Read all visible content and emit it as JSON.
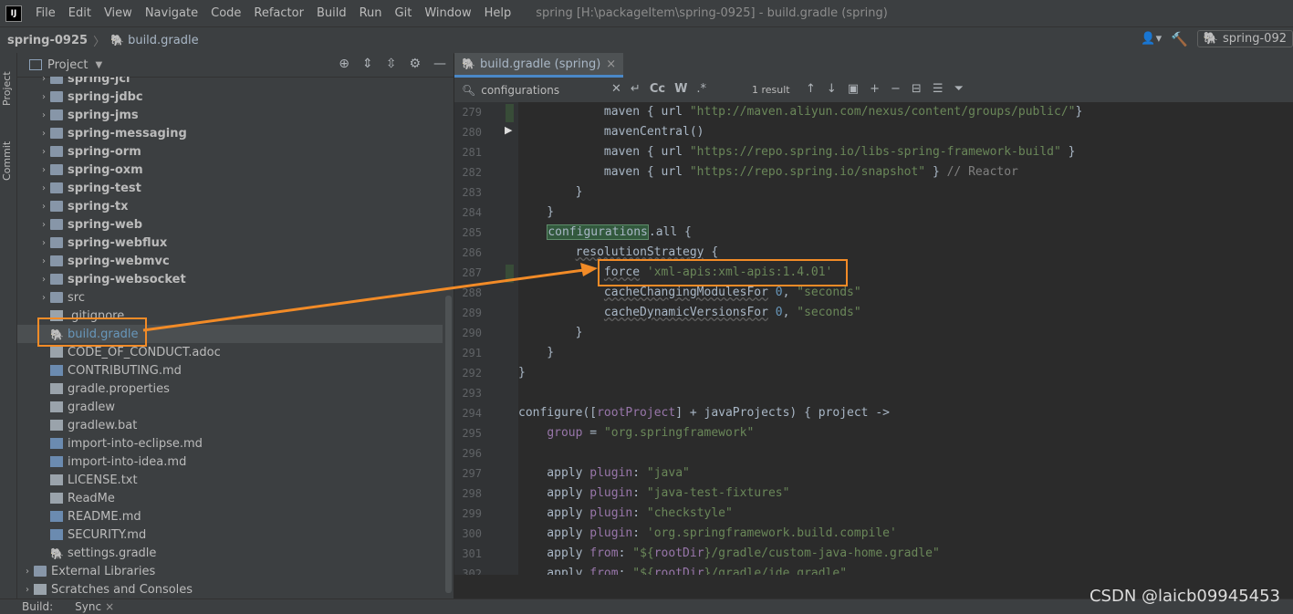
{
  "menubar": {
    "items": [
      "File",
      "Edit",
      "View",
      "Navigate",
      "Code",
      "Refactor",
      "Build",
      "Run",
      "Git",
      "Window",
      "Help"
    ],
    "window_title": "spring [H:\\packageItem\\spring-0925] - build.gradle (spring)"
  },
  "navbar": {
    "project": "spring-0925",
    "file": "build.gradle",
    "run_config": "spring-092"
  },
  "stripe": {
    "project_tab": "Project",
    "commit_tab": "Commit"
  },
  "project_panel": {
    "title": "Project",
    "tree": [
      {
        "label": "spring-jcl",
        "bold": true,
        "type": "module",
        "expand": true
      },
      {
        "label": "spring-jdbc",
        "bold": true,
        "type": "module",
        "expand": true
      },
      {
        "label": "spring-jms",
        "bold": true,
        "type": "module",
        "expand": true
      },
      {
        "label": "spring-messaging",
        "bold": true,
        "type": "module",
        "expand": true
      },
      {
        "label": "spring-orm",
        "bold": true,
        "type": "module",
        "expand": true
      },
      {
        "label": "spring-oxm",
        "bold": true,
        "type": "module",
        "expand": true
      },
      {
        "label": "spring-test",
        "bold": true,
        "type": "module",
        "expand": true
      },
      {
        "label": "spring-tx",
        "bold": true,
        "type": "module",
        "expand": true
      },
      {
        "label": "spring-web",
        "bold": true,
        "type": "module",
        "expand": true
      },
      {
        "label": "spring-webflux",
        "bold": true,
        "type": "module",
        "expand": true
      },
      {
        "label": "spring-webmvc",
        "bold": true,
        "type": "module",
        "expand": true
      },
      {
        "label": "spring-websocket",
        "bold": true,
        "type": "module",
        "expand": true
      },
      {
        "label": "src",
        "bold": false,
        "type": "folder",
        "expand": true
      },
      {
        "label": ".gitignore",
        "bold": false,
        "type": "doc",
        "expand": false
      },
      {
        "label": "build.gradle",
        "bold": false,
        "type": "gradle",
        "expand": false,
        "selected": true
      },
      {
        "label": "CODE_OF_CONDUCT.adoc",
        "bold": false,
        "type": "doc",
        "expand": false
      },
      {
        "label": "CONTRIBUTING.md",
        "bold": false,
        "type": "md",
        "expand": false
      },
      {
        "label": "gradle.properties",
        "bold": false,
        "type": "doc",
        "expand": false
      },
      {
        "label": "gradlew",
        "bold": false,
        "type": "doc",
        "expand": false
      },
      {
        "label": "gradlew.bat",
        "bold": false,
        "type": "doc",
        "expand": false
      },
      {
        "label": "import-into-eclipse.md",
        "bold": false,
        "type": "md",
        "expand": false
      },
      {
        "label": "import-into-idea.md",
        "bold": false,
        "type": "md",
        "expand": false
      },
      {
        "label": "LICENSE.txt",
        "bold": false,
        "type": "doc",
        "expand": false
      },
      {
        "label": "ReadMe",
        "bold": false,
        "type": "doc",
        "expand": false
      },
      {
        "label": "README.md",
        "bold": false,
        "type": "md",
        "expand": false
      },
      {
        "label": "SECURITY.md",
        "bold": false,
        "type": "md",
        "expand": false
      },
      {
        "label": "settings.gradle",
        "bold": false,
        "type": "gradle",
        "expand": false
      },
      {
        "label": "External Libraries",
        "bold": false,
        "type": "lib",
        "expand": true,
        "root": true
      },
      {
        "label": "Scratches and Consoles",
        "bold": false,
        "type": "scratch",
        "expand": true,
        "root": true
      }
    ]
  },
  "editor": {
    "tab": "build.gradle (spring)",
    "search_query": "configurations",
    "search_result": "1 result",
    "first_line": 279,
    "lines": [
      [
        [
          "            maven { url ",
          ""
        ],
        [
          "\"http://maven.aliyun.com/nexus/content/groups/public/\"",
          "str"
        ],
        [
          "}",
          ""
        ]
      ],
      [
        [
          "            mavenCentral()",
          ""
        ]
      ],
      [
        [
          "            maven { url ",
          ""
        ],
        [
          "\"https://repo.spring.io/libs-spring-framework-build\"",
          "str"
        ],
        [
          " }",
          ""
        ]
      ],
      [
        [
          "            maven { url ",
          ""
        ],
        [
          "\"https://repo.spring.io/snapshot\"",
          "str"
        ],
        [
          " } ",
          ""
        ],
        [
          "// Reactor",
          "cmt"
        ]
      ],
      [
        [
          "        }",
          ""
        ]
      ],
      [
        [
          "    }",
          ""
        ]
      ],
      [
        [
          "    ",
          ""
        ],
        [
          "configurations",
          "hl"
        ],
        [
          ".all {",
          ""
        ]
      ],
      [
        [
          "        ",
          ""
        ],
        [
          "resolutionStrategy",
          "dim"
        ],
        [
          " {",
          ""
        ]
      ],
      [
        [
          "            ",
          ""
        ],
        [
          "force",
          "dim"
        ],
        [
          " ",
          ""
        ],
        [
          "'xml-apis:xml-apis:1.4.01'",
          "str"
        ]
      ],
      [
        [
          "            ",
          ""
        ],
        [
          "cacheChangingModulesFor",
          "dim"
        ],
        [
          " ",
          ""
        ],
        [
          "0",
          "num"
        ],
        [
          ", ",
          ""
        ],
        [
          "\"seconds\"",
          "str"
        ]
      ],
      [
        [
          "            ",
          ""
        ],
        [
          "cacheDynamicVersionsFor",
          "dim"
        ],
        [
          " ",
          ""
        ],
        [
          "0",
          "num"
        ],
        [
          ", ",
          ""
        ],
        [
          "\"seconds\"",
          "str"
        ]
      ],
      [
        [
          "        }",
          ""
        ]
      ],
      [
        [
          "    }",
          ""
        ]
      ],
      [
        [
          "}",
          ""
        ]
      ],
      [
        [
          "",
          ""
        ]
      ],
      [
        [
          "configure([",
          ""
        ],
        [
          "rootProject",
          "fld"
        ],
        [
          "] + javaProjects) { project ->",
          ""
        ]
      ],
      [
        [
          "    ",
          ""
        ],
        [
          "group",
          "fld"
        ],
        [
          " = ",
          ""
        ],
        [
          "\"org.springframework\"",
          "str"
        ]
      ],
      [
        [
          "",
          ""
        ]
      ],
      [
        [
          "    apply ",
          ""
        ],
        [
          "plugin",
          "fld"
        ],
        [
          ": ",
          ""
        ],
        [
          "\"java\"",
          "str"
        ]
      ],
      [
        [
          "    apply ",
          ""
        ],
        [
          "plugin",
          "fld"
        ],
        [
          ": ",
          ""
        ],
        [
          "\"java-test-fixtures\"",
          "str"
        ]
      ],
      [
        [
          "    apply ",
          ""
        ],
        [
          "plugin",
          "fld"
        ],
        [
          ": ",
          ""
        ],
        [
          "\"checkstyle\"",
          "str"
        ]
      ],
      [
        [
          "    apply ",
          ""
        ],
        [
          "plugin",
          "fld"
        ],
        [
          ": ",
          ""
        ],
        [
          "'org.springframework.build.compile'",
          "str"
        ]
      ],
      [
        [
          "    apply ",
          ""
        ],
        [
          "from",
          "fld"
        ],
        [
          ": ",
          ""
        ],
        [
          "\"${",
          "str"
        ],
        [
          "rootDir",
          "fld"
        ],
        [
          "}/gradle/custom-java-home.gradle\"",
          "str"
        ]
      ],
      [
        [
          "    apply ",
          ""
        ],
        [
          "from",
          "fld"
        ],
        [
          ": ",
          ""
        ],
        [
          "\"${",
          "str"
        ],
        [
          "rootDir",
          "fld"
        ],
        [
          "}/gradle/ide.gradle\"",
          "str"
        ]
      ]
    ]
  },
  "bottom": {
    "build": "Build:",
    "sync": "Sync"
  },
  "watermark": "CSDN @laicb09945453",
  "colors": {
    "accent_orange": "#f28b27",
    "selection_blue": "#4a88c7"
  }
}
